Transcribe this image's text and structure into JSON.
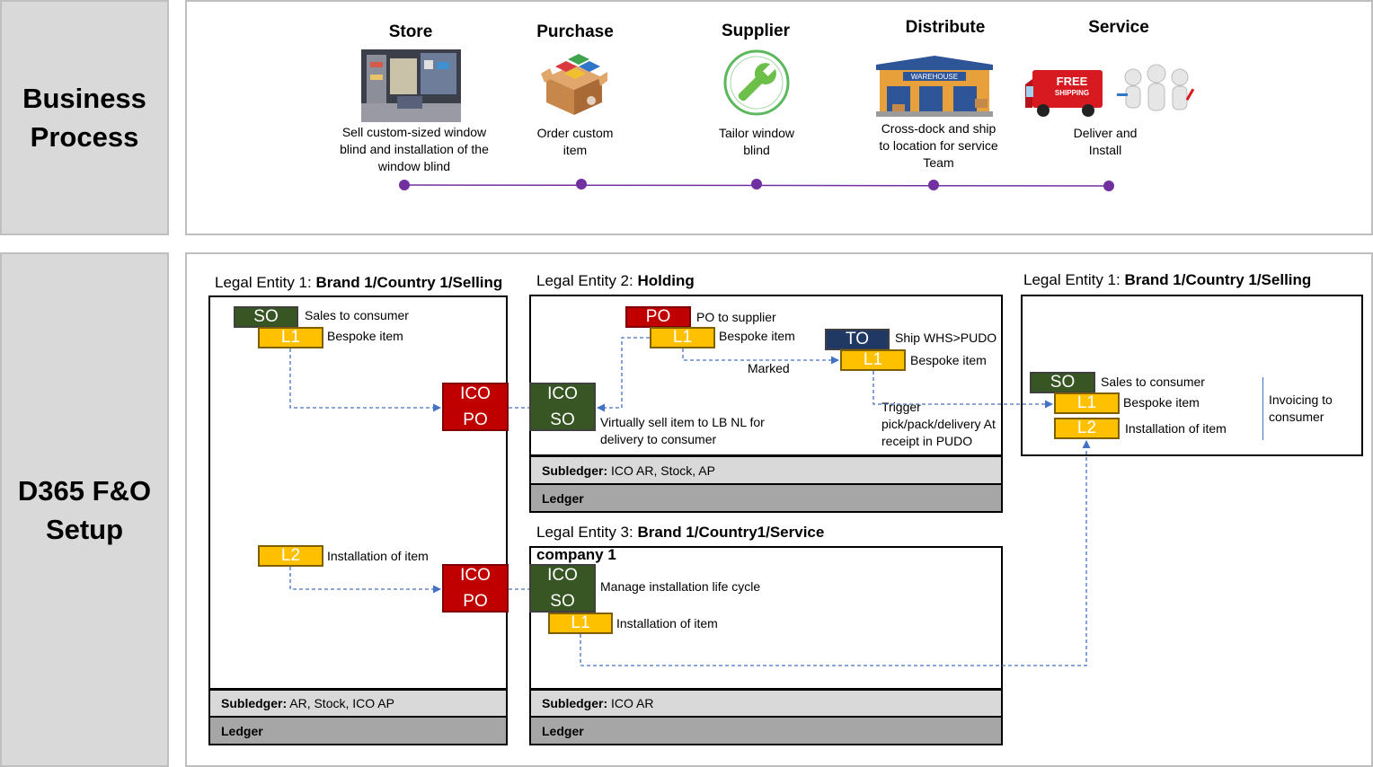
{
  "sidebar": {
    "business_process": "Business Process",
    "d365_setup": "D365 F&O Setup"
  },
  "stages": [
    {
      "title": "Store",
      "desc": "Sell custom-sized window blind and installation of the window blind",
      "icon": "store-photo"
    },
    {
      "title": "Purchase",
      "desc": "Order custom item",
      "icon": "box-icon"
    },
    {
      "title": "Supplier",
      "desc": "Tailor window blind",
      "icon": "wrench-icon"
    },
    {
      "title": "Distribute",
      "desc": "Cross-dock and ship to location for service Team",
      "icon": "warehouse-icon"
    },
    {
      "title": "Service",
      "desc": "Deliver and Install",
      "icon": "truck-icon",
      "truck_text_1": "FREE",
      "truck_text_2": "SHIPPING"
    }
  ],
  "warehouse_label": "WAREHOUSE",
  "entities": {
    "le1_selling": {
      "prefix": "Legal Entity 1: ",
      "name": "Brand 1/Country 1/Selling",
      "so_tag": "SO",
      "so_label": "Sales to consumer",
      "l1_tag": "L1",
      "l1_label": "Bespoke item",
      "l2_tag": "L2",
      "l2_label": "Installation of item",
      "subledger_key": "Subledger:",
      "subledger_val": " AR, Stock, ICO AP",
      "ledger": "Ledger"
    },
    "ico_po_1": {
      "line1": "ICO",
      "line2": "PO"
    },
    "ico_po_2": {
      "line1": "ICO",
      "line2": "PO"
    },
    "le2_holding": {
      "prefix": "Legal Entity 2: ",
      "name": "Holding",
      "po_tag": "PO",
      "po_label": "PO to supplier",
      "l1_tag": "L1",
      "l1_label": "Bespoke item",
      "to_tag": "TO",
      "to_label": "Ship WHS>PUDO",
      "to_l1_tag": "L1",
      "to_l1_label": "Bespoke item",
      "marked": "Marked",
      "ico_so_line1": "ICO",
      "ico_so_line2": "SO",
      "virtual_sell": "Virtually sell item to LB NL for delivery to consumer",
      "trigger": "Trigger pick/pack/delivery At receipt in PUDO",
      "subledger_key": "Subledger:",
      "subledger_val": " ICO AR, Stock, AP",
      "ledger": "Ledger"
    },
    "le3_service": {
      "prefix": "Legal Entity 3: ",
      "name": "Brand 1/Country1/Service",
      "name2": "company 1",
      "ico_so_line1": "ICO",
      "ico_so_line2": "SO",
      "manage": "Manage installation life cycle",
      "l1_tag": "L1",
      "l1_label": "Installation of item",
      "subledger_key": "Subledger:",
      "subledger_val": " ICO AR",
      "ledger": "Ledger"
    },
    "le1_selling_right": {
      "prefix": "Legal Entity 1: ",
      "name": "Brand 1/Country 1/Selling",
      "so_tag": "SO",
      "so_label": "Sales to consumer",
      "l1_tag": "L1",
      "l1_label": "Bespoke item",
      "l2_tag": "L2",
      "l2_label": "Installation of item",
      "invoicing": "Invoicing to consumer"
    }
  },
  "colors": {
    "so_green": "#375623",
    "line_yellow": "#ffc000",
    "po_red": "#c00000",
    "to_navy": "#1f3864",
    "timeline_purple": "#7030a0",
    "arrow_blue": "#4472c4"
  }
}
